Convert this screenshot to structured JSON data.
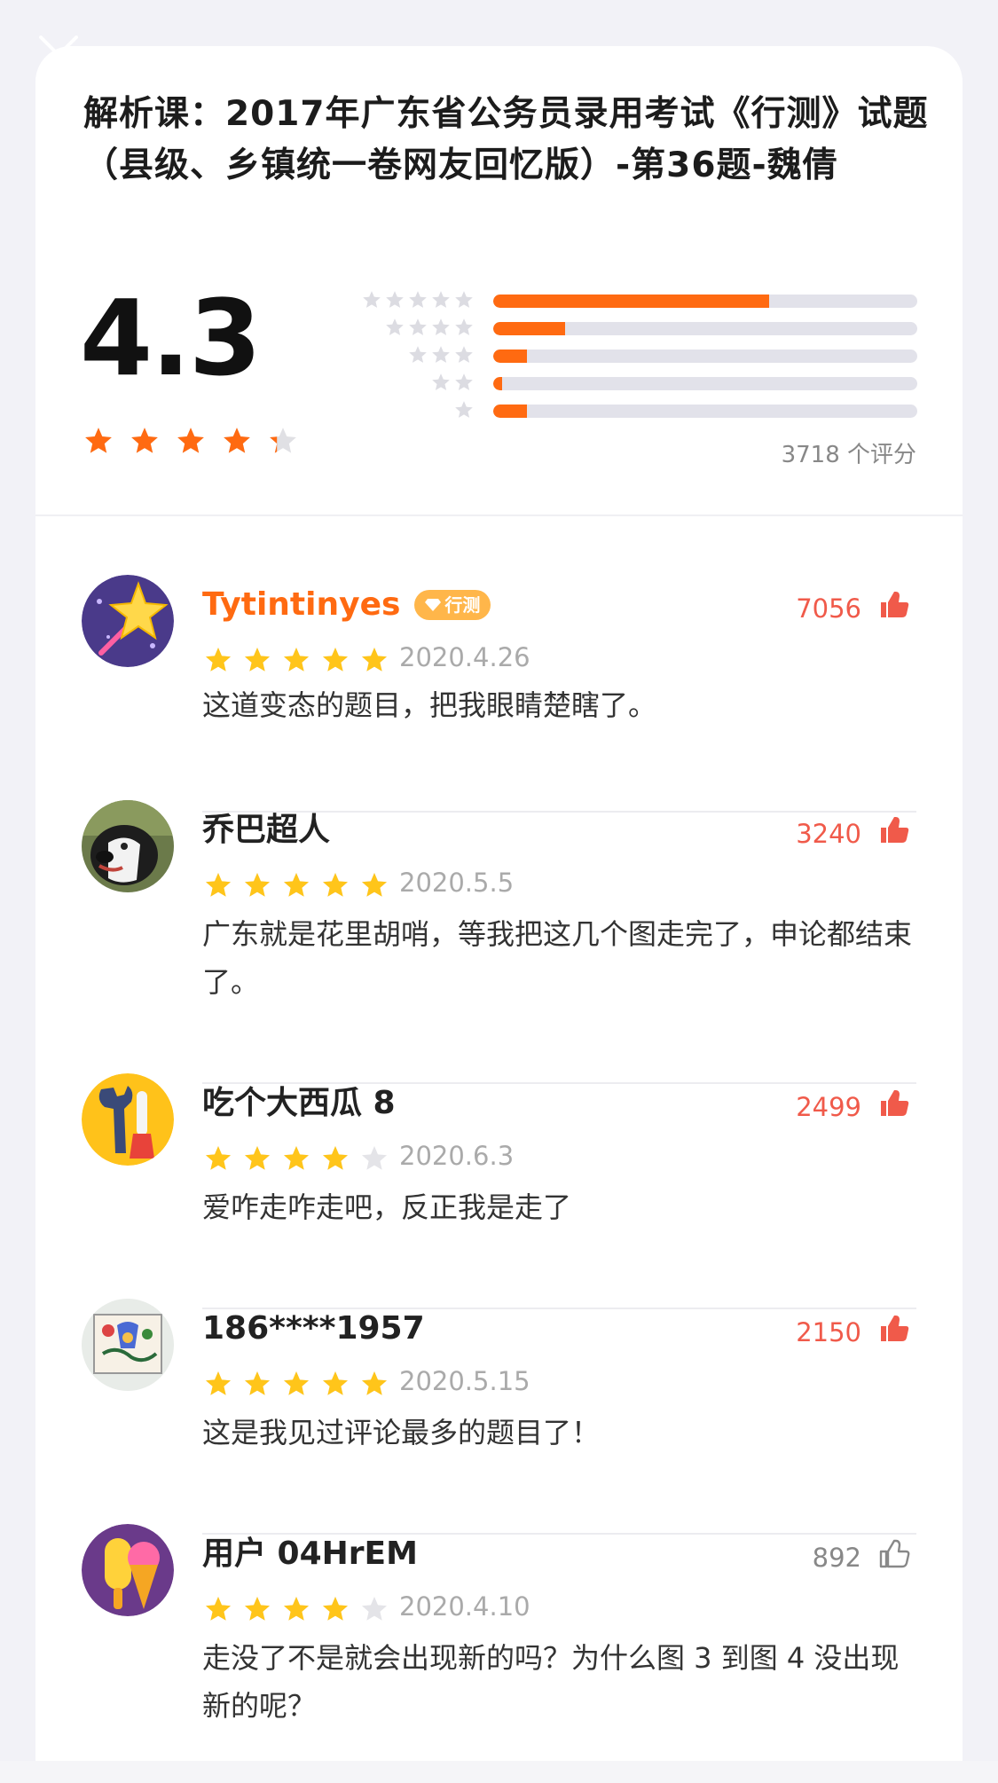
{
  "header": {
    "close_icon": "close-icon",
    "title": "解析课：2017年广东省公务员录用考试《行测》试题（县级、乡镇统一卷网友回忆版）-第36题-魏倩"
  },
  "rating": {
    "average": "4.3",
    "average_value": 4.3,
    "count_label": "3718 个评分",
    "distribution": [
      {
        "stars": 5,
        "fraction": 0.65
      },
      {
        "stars": 4,
        "fraction": 0.17
      },
      {
        "stars": 3,
        "fraction": 0.08
      },
      {
        "stars": 2,
        "fraction": 0.02
      },
      {
        "stars": 1,
        "fraction": 0.08
      }
    ]
  },
  "comments": [
    {
      "name": "Tytintinyes",
      "badge": "行测",
      "likes": "7056",
      "liked": true,
      "stars": 5,
      "date": "2020.4.26",
      "text": "这道变态的题目，把我眼睛楚瞎了。",
      "avatar_icon": "star-wand-avatar"
    },
    {
      "name": "乔巴超人",
      "likes": "3240",
      "liked": true,
      "stars": 5,
      "date": "2020.5.5",
      "text": "广东就是花里胡哨，等我把这几个图走完了，申论都结束了。",
      "avatar_icon": "dog-photo-avatar"
    },
    {
      "name": "吃个大西瓜 8",
      "likes": "2499",
      "liked": true,
      "stars": 4,
      "date": "2020.6.3",
      "text": "爱咋走咋走吧，反正我是走了",
      "avatar_icon": "wrench-screwdriver-avatar"
    },
    {
      "name": "186****1957",
      "likes": "2150",
      "liked": true,
      "stars": 5,
      "date": "2020.5.15",
      "text": "这是我见过评论最多的题目了！",
      "avatar_icon": "drawing-avatar"
    },
    {
      "name": "用户 04HrEM",
      "likes": "892",
      "liked": false,
      "stars": 4,
      "date": "2020.4.10",
      "text": "走没了不是就会出现新的吗？为什么图 3 到图 4 没出现新的呢？",
      "avatar_icon": "popsicle-avatar"
    }
  ],
  "colors": {
    "accent": "#ff6a11",
    "like_red": "#f05a4a",
    "star_grey": "#e0e0e4"
  }
}
